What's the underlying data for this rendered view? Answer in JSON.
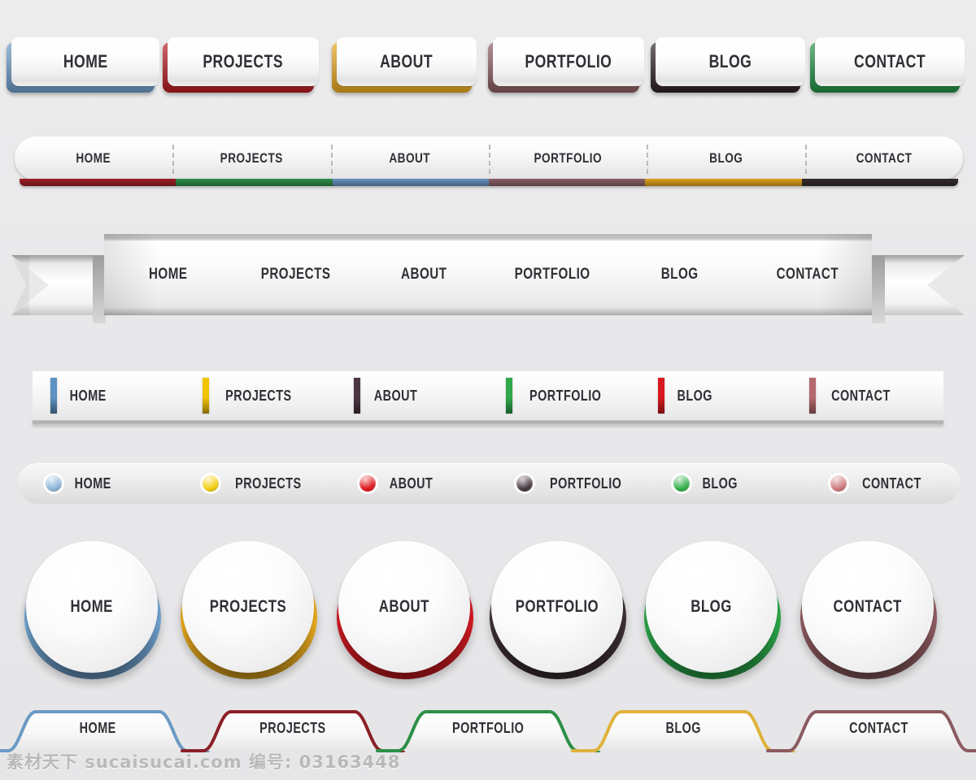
{
  "page": {
    "background": "#e8e8ea",
    "watermark": "素材天下 sucaisucai.com  编号: 03163448"
  },
  "menus": [
    {
      "id": "row1",
      "style_name": "3d-rounded-buttons",
      "items": [
        {
          "label": "HOME",
          "color": "#6a9bc8"
        },
        {
          "label": "PROJECTS",
          "color": "#b5181f"
        },
        {
          "label": "ABOUT",
          "color": "#e8a81d"
        },
        {
          "label": "PORTFOLIO",
          "color": "#8a5a5e"
        },
        {
          "label": "BLOG",
          "color": "#2b2024"
        },
        {
          "label": "CONTACT",
          "color": "#1f9040"
        }
      ]
    },
    {
      "id": "row2",
      "style_name": "pill-bar-underline",
      "items": [
        {
          "label": "HOME",
          "color": "#9e1f26"
        },
        {
          "label": "PROJECTS",
          "color": "#2e8f4a"
        },
        {
          "label": "ABOUT",
          "color": "#6a93c0"
        },
        {
          "label": "PORTFOLIO",
          "color": "#8c6166"
        },
        {
          "label": "BLOG",
          "color": "#e0a21d"
        },
        {
          "label": "CONTACT",
          "color": "#332b2c"
        }
      ]
    },
    {
      "id": "row3",
      "style_name": "ribbon-banner",
      "items": [
        {
          "label": "HOME"
        },
        {
          "label": "PROJECTS"
        },
        {
          "label": "ABOUT"
        },
        {
          "label": "PORTFOLIO"
        },
        {
          "label": "BLOG"
        },
        {
          "label": "CONTACT"
        }
      ]
    },
    {
      "id": "row4",
      "style_name": "flat-bar-color-ticks",
      "items": [
        {
          "label": "HOME",
          "color": "#5e93c4"
        },
        {
          "label": "PROJECTS",
          "color": "#f2c400"
        },
        {
          "label": "ABOUT",
          "color": "#4b3742"
        },
        {
          "label": "PORTFOLIO",
          "color": "#2fa84a"
        },
        {
          "label": "BLOG",
          "color": "#d81920"
        },
        {
          "label": "CONTACT",
          "color": "#b5696d"
        }
      ]
    },
    {
      "id": "row5",
      "style_name": "rounded-bar-bullets",
      "items": [
        {
          "label": "HOME",
          "color": "#8fb8dc"
        },
        {
          "label": "PROJECTS",
          "color": "#f5cf12"
        },
        {
          "label": "ABOUT",
          "color": "#e01a1e"
        },
        {
          "label": "PORTFOLIO",
          "color": "#4a3b43"
        },
        {
          "label": "BLOG",
          "color": "#34b04a"
        },
        {
          "label": "CONTACT",
          "color": "#cf7a80"
        }
      ]
    },
    {
      "id": "row6",
      "style_name": "circular-buttons",
      "items": [
        {
          "label": "HOME",
          "color": "#6fa1ce"
        },
        {
          "label": "PROJECTS",
          "color": "#e8ab1f"
        },
        {
          "label": "ABOUT",
          "color": "#cf1b22"
        },
        {
          "label": "PORTFOLIO",
          "color": "#3d3035"
        },
        {
          "label": "BLOG",
          "color": "#2ba martin"
        },
        {
          "label": "CONTACT",
          "color": "#8e5b60"
        }
      ]
    },
    {
      "id": "row7",
      "style_name": "wavy-tabs",
      "items": [
        {
          "label": "HOME",
          "color": "#6b99c4"
        },
        {
          "label": "PROJECTS",
          "color": "#8b2026"
        },
        {
          "label": "PORTFOLIO",
          "color": "#2d8f46"
        },
        {
          "label": "BLOG",
          "color": "#e0b23b"
        },
        {
          "label": "CONTACT",
          "color": "#8a5b5f"
        }
      ]
    }
  ]
}
